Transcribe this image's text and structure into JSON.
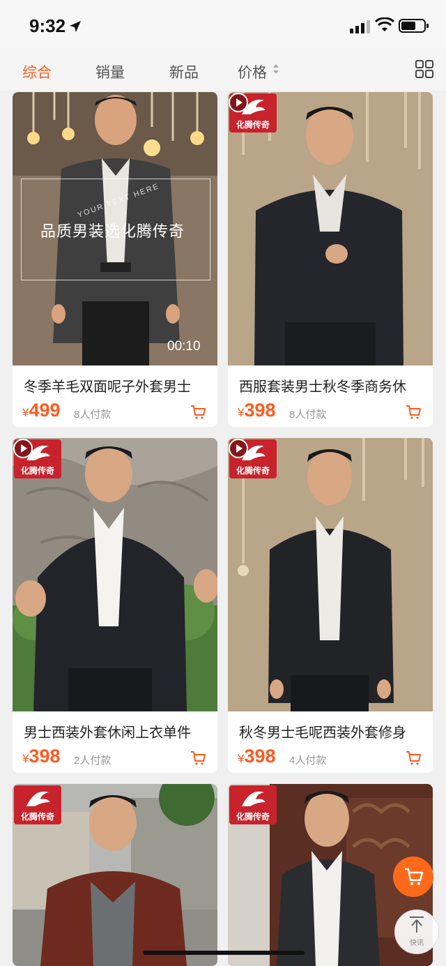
{
  "status_bar": {
    "time": "9:32"
  },
  "sort_tabs": [
    {
      "label": "综合",
      "active": true
    },
    {
      "label": "销量",
      "active": false
    },
    {
      "label": "新品",
      "active": false
    },
    {
      "label": "价格",
      "active": false
    }
  ],
  "brand_label": "化腾传奇",
  "products": [
    {
      "name": "冬季羊毛双面呢子外套男士",
      "currency": "¥",
      "price": "499",
      "sales": "8人付款",
      "video_duration": "00:10",
      "overlay_text": "品质男装选化腾传奇",
      "watermark": "YOUR TEXT HERE"
    },
    {
      "name": "西服套装男士秋冬季商务休",
      "currency": "¥",
      "price": "398",
      "sales": "8人付款"
    },
    {
      "name": "男士西装外套休闲上衣单件",
      "currency": "¥",
      "price": "398",
      "sales": "2人付款"
    },
    {
      "name": "秋冬男士毛呢西装外套修身",
      "currency": "¥",
      "price": "398",
      "sales": "4人付款"
    },
    {
      "name": "",
      "currency": "",
      "price": "",
      "sales": ""
    },
    {
      "name": "",
      "currency": "",
      "price": "",
      "sales": ""
    }
  ],
  "floating": {
    "back_to_top_label": "快讯"
  },
  "colors": {
    "accent": "#ff5a1f",
    "brand_red": "#c8232c"
  },
  "icons": [
    "location-arrow-icon",
    "signal-icon",
    "wifi-icon",
    "battery-icon",
    "sort-arrows-icon",
    "grid-toggle-icon",
    "cart-icon",
    "play-icon",
    "back-to-top-icon"
  ]
}
